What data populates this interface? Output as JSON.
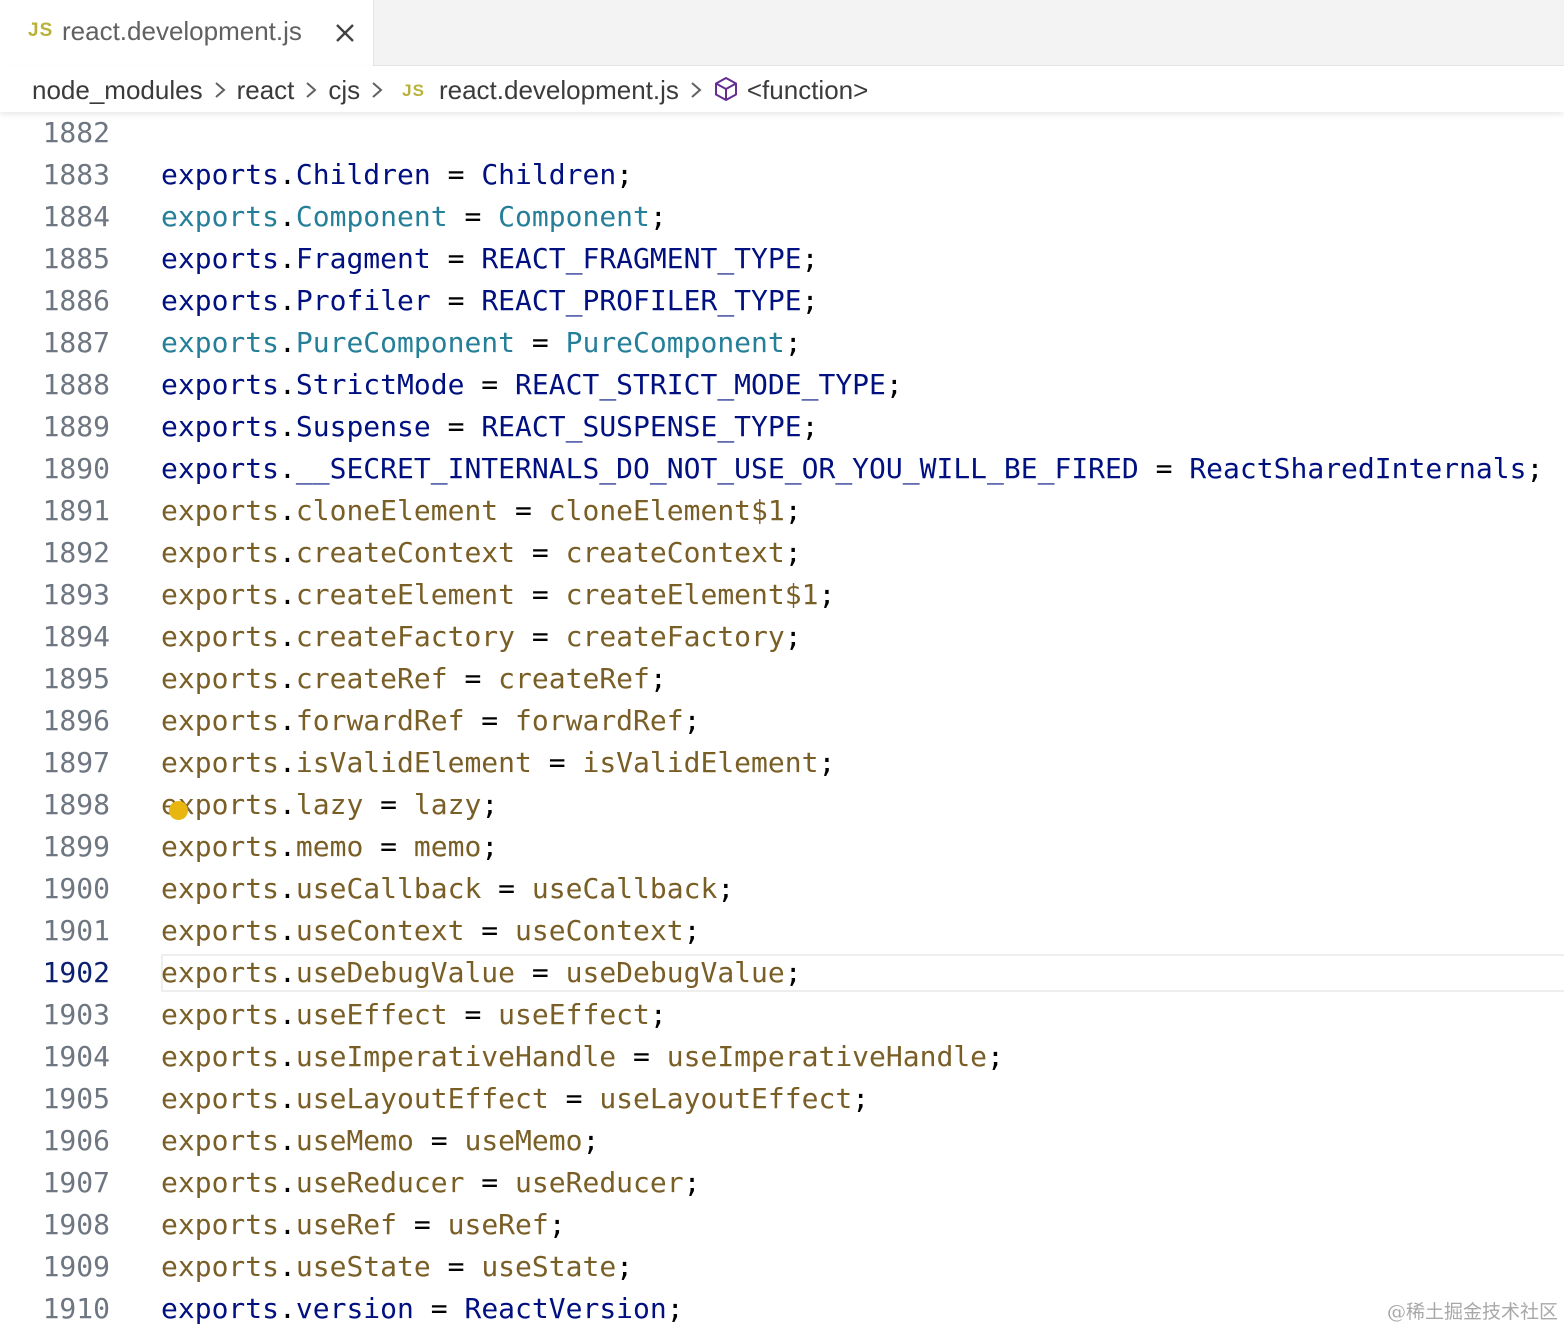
{
  "tab": {
    "badge": "JS",
    "title": "react.development.js",
    "close_icon": "close-icon"
  },
  "breadcrumb": {
    "items": [
      "node_modules",
      "react",
      "cjs"
    ],
    "file_badge": "JS",
    "file": "react.development.js",
    "symbol_icon": "cube-icon",
    "symbol": "<function>"
  },
  "colors": {
    "variable": "#001080",
    "class": "#267f99",
    "function": "#795e26",
    "line_number": "#6e7681",
    "current_line_number": "#0b216f",
    "js_badge": "#b8b23a",
    "lightbulb": "#e8b60e"
  },
  "current_line": "1902",
  "lines": [
    {
      "n": "1882",
      "prop": "",
      "rhs": "",
      "kind": "empty"
    },
    {
      "n": "1883",
      "prop": "Children",
      "rhs": "Children",
      "kind": "var"
    },
    {
      "n": "1884",
      "prop": "Component",
      "rhs": "Component",
      "kind": "class"
    },
    {
      "n": "1885",
      "prop": "Fragment",
      "rhs": "REACT_FRAGMENT_TYPE",
      "kind": "var"
    },
    {
      "n": "1886",
      "prop": "Profiler",
      "rhs": "REACT_PROFILER_TYPE",
      "kind": "var"
    },
    {
      "n": "1887",
      "prop": "PureComponent",
      "rhs": "PureComponent",
      "kind": "class"
    },
    {
      "n": "1888",
      "prop": "StrictMode",
      "rhs": "REACT_STRICT_MODE_TYPE",
      "kind": "var"
    },
    {
      "n": "1889",
      "prop": "Suspense",
      "rhs": "REACT_SUSPENSE_TYPE",
      "kind": "var"
    },
    {
      "n": "1890",
      "prop": "__SECRET_INTERNALS_DO_NOT_USE_OR_YOU_WILL_BE_FIRED",
      "rhs": "ReactSharedInternals",
      "kind": "var"
    },
    {
      "n": "1891",
      "prop": "cloneElement",
      "rhs": "cloneElement$1",
      "kind": "fn"
    },
    {
      "n": "1892",
      "prop": "createContext",
      "rhs": "createContext",
      "kind": "fn"
    },
    {
      "n": "1893",
      "prop": "createElement",
      "rhs": "createElement$1",
      "kind": "fn"
    },
    {
      "n": "1894",
      "prop": "createFactory",
      "rhs": "createFactory",
      "kind": "fn"
    },
    {
      "n": "1895",
      "prop": "createRef",
      "rhs": "createRef",
      "kind": "fn"
    },
    {
      "n": "1896",
      "prop": "forwardRef",
      "rhs": "forwardRef",
      "kind": "fn"
    },
    {
      "n": "1897",
      "prop": "isValidElement",
      "rhs": "isValidElement",
      "kind": "fn"
    },
    {
      "n": "1898",
      "prop": "lazy",
      "rhs": "lazy",
      "kind": "fn"
    },
    {
      "n": "1899",
      "prop": "memo",
      "rhs": "memo",
      "kind": "fn"
    },
    {
      "n": "1900",
      "prop": "useCallback",
      "rhs": "useCallback",
      "kind": "fn"
    },
    {
      "n": "1901",
      "prop": "useContext",
      "rhs": "useContext",
      "kind": "fn"
    },
    {
      "n": "1902",
      "prop": "useDebugValue",
      "rhs": "useDebugValue",
      "kind": "fn"
    },
    {
      "n": "1903",
      "prop": "useEffect",
      "rhs": "useEffect",
      "kind": "fn"
    },
    {
      "n": "1904",
      "prop": "useImperativeHandle",
      "rhs": "useImperativeHandle",
      "kind": "fn"
    },
    {
      "n": "1905",
      "prop": "useLayoutEffect",
      "rhs": "useLayoutEffect",
      "kind": "fn"
    },
    {
      "n": "1906",
      "prop": "useMemo",
      "rhs": "useMemo",
      "kind": "fn"
    },
    {
      "n": "1907",
      "prop": "useReducer",
      "rhs": "useReducer",
      "kind": "fn"
    },
    {
      "n": "1908",
      "prop": "useRef",
      "rhs": "useRef",
      "kind": "fn"
    },
    {
      "n": "1909",
      "prop": "useState",
      "rhs": "useState",
      "kind": "fn"
    },
    {
      "n": "1910",
      "prop": "version",
      "rhs": "ReactVersion",
      "kind": "var"
    }
  ],
  "code": {
    "object": "exports",
    "dot": ".",
    "assign": " = ",
    "semicolon": ";"
  },
  "lightbulb_icon": "lightbulb-icon",
  "watermark": "@稀土掘金技术社区"
}
